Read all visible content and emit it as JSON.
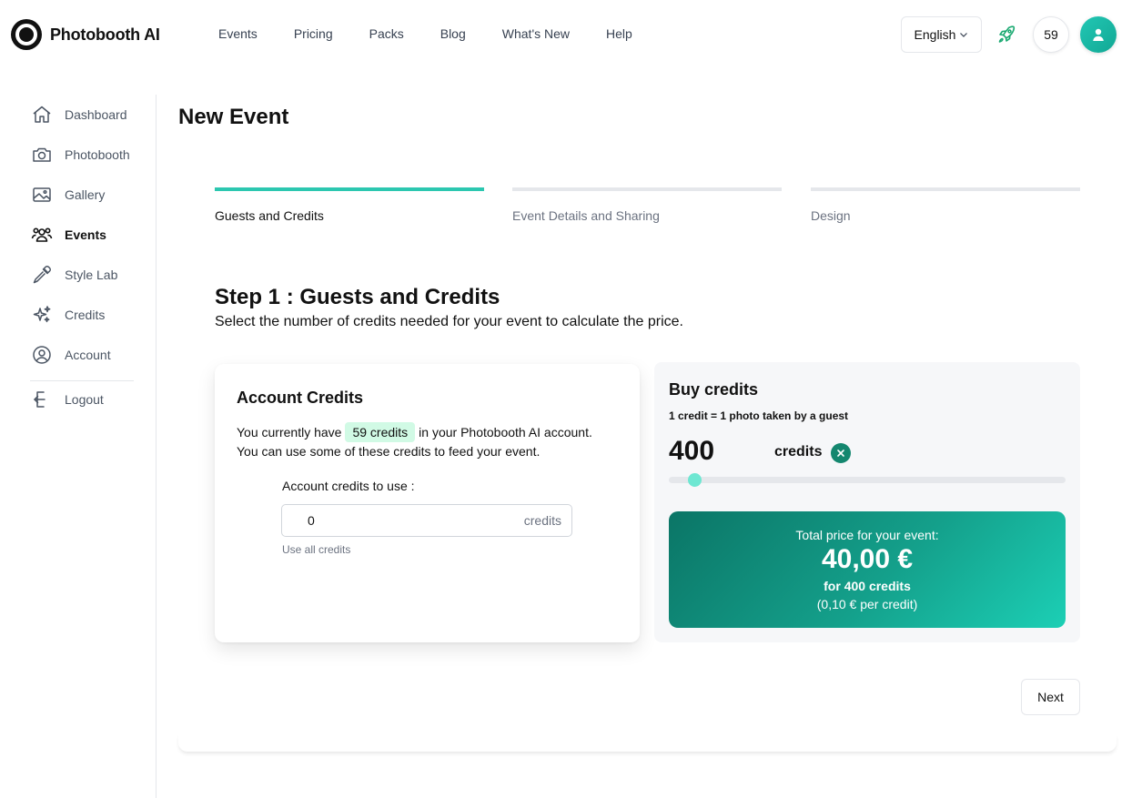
{
  "brand": {
    "name": "Photobooth AI"
  },
  "nav": {
    "links": [
      "Events",
      "Pricing",
      "Packs",
      "Blog",
      "What's New",
      "Help"
    ]
  },
  "header": {
    "language": "English",
    "credits": "59"
  },
  "sidebar": {
    "items": [
      {
        "label": "Dashboard",
        "icon": "home-icon"
      },
      {
        "label": "Photobooth",
        "icon": "camera-icon"
      },
      {
        "label": "Gallery",
        "icon": "image-icon"
      },
      {
        "label": "Events",
        "icon": "users-icon",
        "active": true
      },
      {
        "label": "Style Lab",
        "icon": "eyedropper-icon"
      },
      {
        "label": "Credits",
        "icon": "sparkles-icon"
      },
      {
        "label": "Account",
        "icon": "user-circle-icon"
      }
    ],
    "logout": {
      "label": "Logout",
      "icon": "logout-icon"
    }
  },
  "page": {
    "title": "New Event"
  },
  "steps": [
    {
      "label": "Guests and Credits",
      "active": true
    },
    {
      "label": "Event Details and Sharing",
      "active": false
    },
    {
      "label": "Design",
      "active": false
    }
  ],
  "step1": {
    "heading": "Step 1 : Guests and Credits",
    "description": "Select the number of credits needed for your event to calculate the price."
  },
  "account_credits": {
    "title": "Account Credits",
    "text_before": "You currently have",
    "credits_badge": "59 credits",
    "text_after": "in your Photobooth AI account.",
    "text_line2": "You can use some of these credits to feed your event.",
    "input_label": "Account credits to use :",
    "input_value": "0",
    "input_unit": "credits",
    "use_all": "Use all credits"
  },
  "buy_credits": {
    "title": "Buy credits",
    "subtitle": "1 credit = 1 photo taken by a guest",
    "amount": "400",
    "unit": "credits",
    "slider_level": 0.06,
    "price_caption": "Total price for your event:",
    "price_total": "40,00 €",
    "price_for": "for 400 credits",
    "price_per": "(0,10 € per credit)"
  },
  "actions": {
    "next": "Next"
  },
  "colors": {
    "accent": "#2cc7b0",
    "credit_badge_bg": "#d1fae5",
    "price_gradient_start": "#0b7566",
    "price_gradient_end": "#1ccfb5",
    "clear_button": "#14876f"
  }
}
